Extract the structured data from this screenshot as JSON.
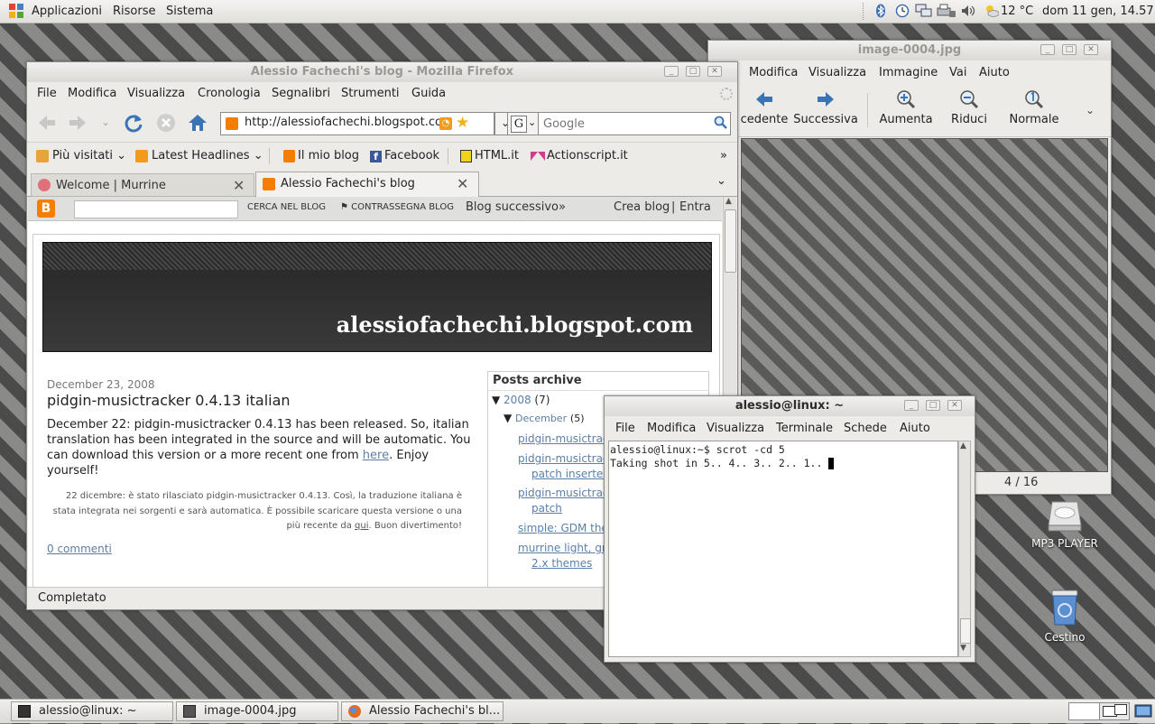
{
  "top_panel": {
    "menus": [
      "Applicazioni",
      "Risorse",
      "Sistema"
    ],
    "weather": "12 °C",
    "clock": "dom 11 gen, 14.57"
  },
  "firefox": {
    "title": "Alessio Fachechi's blog - Mozilla Firefox",
    "menus": [
      "File",
      "Modifica",
      "Visualizza",
      "Cronologia",
      "Segnalibri",
      "Strumenti",
      "Guida"
    ],
    "url": "http://alessiofachechi.blogspot.com",
    "search_placeholder": "Google",
    "bookmarks": [
      "Più visitati",
      "Latest Headlines",
      "Il mio blog",
      "Facebook",
      "HTML.it",
      "Actionscript.it"
    ],
    "bookmarks_more": "»",
    "tabs": [
      {
        "label": "Welcome | Murrine"
      },
      {
        "label": "Alessio Fachechi's blog"
      }
    ],
    "blogger_bar": {
      "search_button": "CERCA NEL BLOG",
      "flag_button": "CONTRASSEGNA BLOG",
      "next_blog": "Blog successivo»",
      "create": "Crea blog",
      "separator": "|",
      "login": "Entra"
    },
    "blog": {
      "header_title": "alessiofachechi.blogspot.com",
      "post_date": "December 23, 2008",
      "post_title": "pidgin-musictracker 0.4.13 italian",
      "post_body_1": "December 22: pidgin-musictracker 0.4.13 has been released. So, italian translation has been integrated in the source and will be automatic. You can download this version or a more recent one from ",
      "post_link": "here",
      "post_body_2": ". Enjoy yourself!",
      "italian_1": "22 dicembre: è stato rilasciato pidgin-musictracker 0.4.13. Così, la traduzione italiana è stata integrata nei sorgenti e sarà automatica. È possibile scaricare questa versione o una più recente da ",
      "italian_link": "qui",
      "italian_2": ". Buon divertimento!",
      "comments": "0 commenti",
      "archive": {
        "title": "Posts archive",
        "year": "2008",
        "year_count": "(7)",
        "month": "December",
        "month_count": "(5)",
        "items": [
          "pidgin-musictrack",
          "pidgin-musictrack",
          "patch inserted",
          "pidgin-musictrack",
          "patch",
          "simple: GDM ther",
          "murrine light, gra",
          "2.x themes"
        ]
      }
    },
    "status": "Completato"
  },
  "image_viewer": {
    "title": "image-0004.jpg",
    "menus": [
      "Modifica",
      "Visualizza",
      "Immagine",
      "Vai",
      "Aiuto"
    ],
    "toolbar": [
      "cedente",
      "Successiva",
      "Aumenta",
      "Riduci",
      "Normale"
    ],
    "counter": "4 / 16"
  },
  "terminal": {
    "title": "alessio@linux: ~",
    "menus": [
      "File",
      "Modifica",
      "Visualizza",
      "Terminale",
      "Schede",
      "Aiuto"
    ],
    "lines": [
      "alessio@linux:~$ scrot -cd 5",
      "Taking shot in 5.. 4.. 3.. 2.. 1.."
    ]
  },
  "desktop_icons": [
    "MP3 PLAYER",
    "Cestino"
  ],
  "taskbar": [
    "alessio@linux: ~",
    "image-0004.jpg",
    "Alessio Fachechi's bl..."
  ],
  "colors": {
    "link": "#5b7fa8",
    "accent_blue": "#3a74b5",
    "blogger_orange": "#f57d00"
  }
}
